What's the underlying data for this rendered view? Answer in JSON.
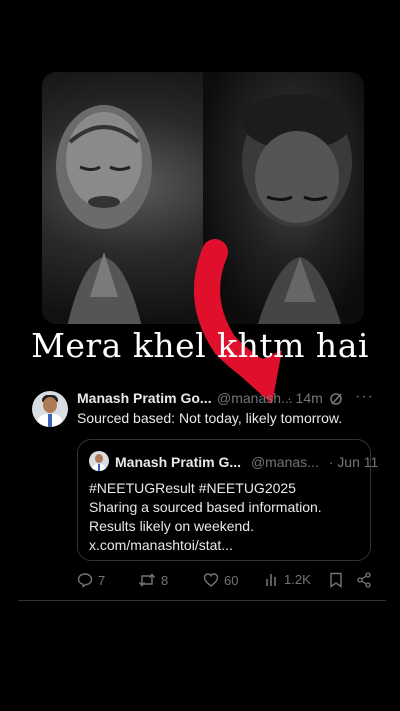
{
  "caption": "Mera khel khtm hai",
  "tweet": {
    "author_name": "Manash Pratim Go...",
    "author_handle": "@manash...",
    "time": "· 14m",
    "text": "Sourced based: Not today, likely tomorrow.",
    "more_label": "···",
    "quote": {
      "author_name": "Manash Pratim G...",
      "author_handle": "@manas...",
      "date": "· Jun 11",
      "line1": "#NEETUGResult #NEETUG2025",
      "line2": "Sharing a sourced based information.",
      "line3": "Results likely on weekend.",
      "line4": "x.com/manashtoi/stat..."
    },
    "actions": {
      "replies": "7",
      "reposts": "8",
      "likes": "60",
      "views": "1.2K"
    }
  },
  "colors": {
    "background": "#000000",
    "text": "#e7e9ea",
    "muted": "#71767b",
    "border": "#2f3336",
    "arrow": "#e0102c"
  }
}
